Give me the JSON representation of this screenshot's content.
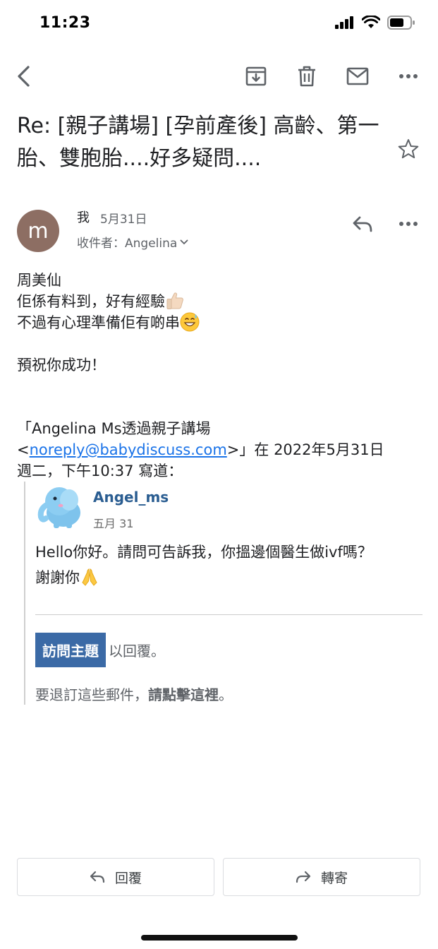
{
  "status_bar": {
    "time": "11:23"
  },
  "toolbar": {
    "back": "back-icon",
    "archive": "archive-icon",
    "delete": "trash-icon",
    "mark_unread": "mail-icon",
    "more": "more-icon"
  },
  "email": {
    "subject": "Re: [親子講場] [孕前產後] 高齡、第一胎、雙胞胎....好多疑問....",
    "sender": {
      "avatar_letter": "m",
      "name": "我",
      "date": "5月31日",
      "recipient": "收件者：Angelina"
    },
    "body": {
      "line1": "周美仙",
      "line2": "佢係有料到，好有經驗",
      "line3": "不過有心理準備佢有啲串",
      "line4": "預祝你成功！"
    },
    "quote_header": {
      "part1": "「Angelina Ms透過親子講場",
      "email_link": "noreply@babydiscuss.com",
      "part2": "」在 2022年5月31日",
      "part3": "週二，下午10:37 寫道：",
      "open_bracket": "<",
      "close_bracket": ">"
    },
    "quoted": {
      "username": "Angel_ms",
      "date": "五月 31",
      "message_line1": "Hello你好。請問可告訴我，你搵邊個醫生做ivf嗎？",
      "message_line2": "謝謝你",
      "visit_button": "訪問主題",
      "visit_suffix": "以回覆。",
      "unsub_prefix": "要退訂這些郵件，",
      "unsub_link": "請點擊這裡",
      "unsub_suffix": "。"
    }
  },
  "actions": {
    "reply_label": "回覆",
    "forward_label": "轉寄"
  },
  "colors": {
    "accent_blue": "#1a73e8",
    "avatar": "#8d6e63",
    "forum_blue": "#3b6aa6",
    "username_blue": "#2a5d91"
  }
}
